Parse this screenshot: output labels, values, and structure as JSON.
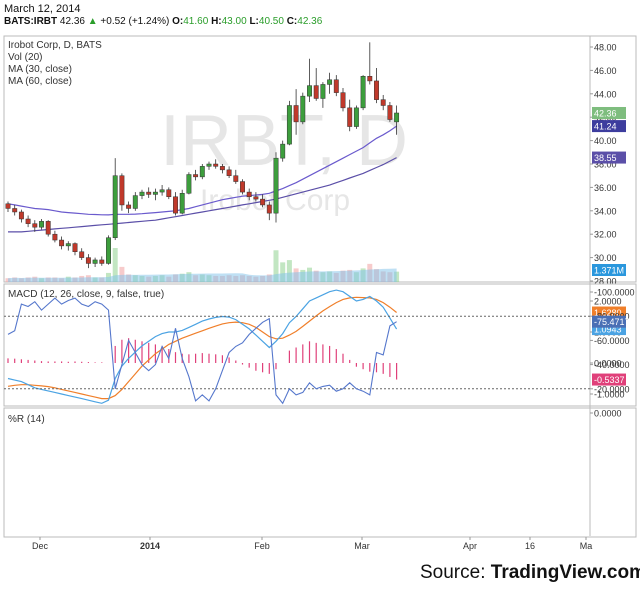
{
  "header": {
    "date": "March 12, 2014",
    "symbol": "BATS:IRBT",
    "last": "42.36",
    "change": "+0.52 (+1.24%)",
    "o_label": "O:",
    "o": "41.60",
    "h_label": "H:",
    "h": "43.00",
    "l_label": "L:",
    "l": "40.50",
    "c_label": "C:",
    "c": "42.36"
  },
  "watermark": {
    "ticker": "IRBT, D",
    "name": "Irobot Corp"
  },
  "source": {
    "prefix": "Source: ",
    "brand": "TradingView.com"
  },
  "colors": {
    "up": "#3d9e3d",
    "down": "#c0392b",
    "ma30": "#5b4fa8",
    "ma60": "#6a5acd",
    "macd": "#4ba3e3",
    "signal": "#f07f2a",
    "hist": "#e0407a",
    "willr": "#5577cc",
    "willr_band": "#ecdcf7"
  },
  "chart_data": [
    {
      "type": "candlestick",
      "title": "Irobot Corp, D, BATS",
      "legend": [
        "Irobot Corp, D, BATS",
        "Vol (20)",
        "MA (30, close)",
        "MA (60, close)"
      ],
      "x_ticks": [
        "Dec",
        "2014",
        "Feb",
        "Mar",
        "Apr",
        "16",
        "Ma"
      ],
      "y_ticks": [
        "28.00",
        "30.00",
        "32.00",
        "34.00",
        "36.00",
        "38.00",
        "40.00",
        "42.00",
        "44.00",
        "46.00",
        "48.00"
      ],
      "ylim": [
        28,
        48.5
      ],
      "last_labels": {
        "close": "42.36",
        "ma30": "41.24",
        "ma60": "38.55",
        "volume": "1.371M"
      },
      "ohlc": [
        [
          34.6,
          34.8,
          33.9,
          34.2
        ],
        [
          34.2,
          34.5,
          33.6,
          33.9
        ],
        [
          33.9,
          34.1,
          33.0,
          33.3
        ],
        [
          33.3,
          33.6,
          32.6,
          32.9
        ],
        [
          32.9,
          33.2,
          32.2,
          32.6
        ],
        [
          32.6,
          33.3,
          32.4,
          33.1
        ],
        [
          33.1,
          33.2,
          31.8,
          32.0
        ],
        [
          32.0,
          32.3,
          31.3,
          31.5
        ],
        [
          31.5,
          31.8,
          30.7,
          31.0
        ],
        [
          31.0,
          31.4,
          30.6,
          31.2
        ],
        [
          31.2,
          31.3,
          30.2,
          30.5
        ],
        [
          30.5,
          30.8,
          29.8,
          30.0
        ],
        [
          30.0,
          30.3,
          29.1,
          29.5
        ],
        [
          29.5,
          30.0,
          29.2,
          29.8
        ],
        [
          29.8,
          30.1,
          29.3,
          29.5
        ],
        [
          29.5,
          31.9,
          29.4,
          31.7
        ],
        [
          31.7,
          38.5,
          31.5,
          37.0
        ],
        [
          37.0,
          37.2,
          34.0,
          34.5
        ],
        [
          34.5,
          34.8,
          33.8,
          34.2
        ],
        [
          34.2,
          35.6,
          34.0,
          35.3
        ],
        [
          35.3,
          35.8,
          35.0,
          35.6
        ],
        [
          35.6,
          36.0,
          35.1,
          35.4
        ],
        [
          35.4,
          35.9,
          34.9,
          35.6
        ],
        [
          35.6,
          36.2,
          35.3,
          35.8
        ],
        [
          35.8,
          36.0,
          35.0,
          35.2
        ],
        [
          35.2,
          35.6,
          33.6,
          33.8
        ],
        [
          33.8,
          35.8,
          33.7,
          35.5
        ],
        [
          35.5,
          37.3,
          35.4,
          37.1
        ],
        [
          37.1,
          37.5,
          36.6,
          36.9
        ],
        [
          36.9,
          38.0,
          36.7,
          37.8
        ],
        [
          37.8,
          38.2,
          37.5,
          38.0
        ],
        [
          38.0,
          38.4,
          37.6,
          37.8
        ],
        [
          37.8,
          38.0,
          37.2,
          37.5
        ],
        [
          37.5,
          37.8,
          36.8,
          37.0
        ],
        [
          37.0,
          37.5,
          36.3,
          36.5
        ],
        [
          36.5,
          36.7,
          35.4,
          35.6
        ],
        [
          35.6,
          35.9,
          34.9,
          35.2
        ],
        [
          35.2,
          35.6,
          34.8,
          35.0
        ],
        [
          35.0,
          35.4,
          34.3,
          34.5
        ],
        [
          34.5,
          34.8,
          33.2,
          33.8
        ],
        [
          33.8,
          39.0,
          33.0,
          38.5
        ],
        [
          38.5,
          40.0,
          38.2,
          39.7
        ],
        [
          39.7,
          43.4,
          39.6,
          43.0
        ],
        [
          43.0,
          44.4,
          40.5,
          41.6
        ],
        [
          41.6,
          44.1,
          41.4,
          43.8
        ],
        [
          43.8,
          47.0,
          43.3,
          44.7
        ],
        [
          44.7,
          46.2,
          43.4,
          43.6
        ],
        [
          43.6,
          45.0,
          42.8,
          44.8
        ],
        [
          44.8,
          45.8,
          44.0,
          45.2
        ],
        [
          45.2,
          45.6,
          43.8,
          44.1
        ],
        [
          44.1,
          44.5,
          42.5,
          42.8
        ],
        [
          42.8,
          43.5,
          40.8,
          41.2
        ],
        [
          41.2,
          43.0,
          41.0,
          42.8
        ],
        [
          42.8,
          45.6,
          42.6,
          45.5
        ],
        [
          45.5,
          48.4,
          44.8,
          45.1
        ],
        [
          45.1,
          46.2,
          43.2,
          43.5
        ],
        [
          43.5,
          43.9,
          42.6,
          43.0
        ],
        [
          43.0,
          43.3,
          41.6,
          41.8
        ],
        [
          41.6,
          43.0,
          40.5,
          42.36
        ]
      ],
      "volume": [
        0.5,
        0.6,
        0.5,
        0.6,
        0.7,
        0.5,
        0.6,
        0.6,
        0.5,
        0.7,
        0.6,
        0.8,
        0.9,
        0.6,
        0.6,
        1.2,
        4.5,
        2.0,
        1.0,
        0.9,
        0.8,
        0.7,
        0.8,
        0.9,
        0.7,
        1.0,
        1.1,
        1.3,
        0.9,
        1.0,
        0.9,
        0.8,
        0.8,
        0.9,
        0.8,
        0.9,
        0.8,
        0.7,
        0.8,
        1.0,
        4.2,
        2.6,
        2.9,
        1.8,
        1.6,
        1.9,
        1.5,
        1.3,
        1.4,
        1.2,
        1.5,
        1.6,
        1.3,
        1.8,
        2.4,
        1.7,
        1.4,
        1.3,
        1.371
      ],
      "ma30": [
        34.6,
        34.5,
        34.4,
        34.3,
        34.2,
        34.15,
        34.1,
        34.0,
        33.9,
        33.85,
        33.8,
        33.75,
        33.7,
        33.68,
        33.66,
        33.65,
        33.7,
        33.7,
        33.7,
        33.72,
        33.75,
        33.8,
        33.85,
        33.9,
        33.95,
        34.0,
        34.1,
        34.2,
        34.35,
        34.5,
        34.65,
        34.8,
        34.95,
        35.05,
        35.15,
        35.25,
        35.3,
        35.35,
        35.4,
        35.5,
        35.7,
        35.9,
        36.15,
        36.4,
        36.7,
        37.0,
        37.3,
        37.6,
        37.9,
        38.2,
        38.5,
        38.8,
        39.1,
        39.4,
        39.8,
        40.2,
        40.5,
        40.85,
        41.24
      ],
      "ma60": [
        32.2,
        32.2,
        32.2,
        32.25,
        32.3,
        32.35,
        32.4,
        32.45,
        32.5,
        32.55,
        32.6,
        32.65,
        32.7,
        32.75,
        32.8,
        32.85,
        32.9,
        32.95,
        33.0,
        33.05,
        33.1,
        33.15,
        33.2,
        33.3,
        33.4,
        33.5,
        33.6,
        33.7,
        33.8,
        33.9,
        34.0,
        34.1,
        34.2,
        34.3,
        34.4,
        34.5,
        34.6,
        34.7,
        34.8,
        34.9,
        35.0,
        35.15,
        35.3,
        35.45,
        35.6,
        35.75,
        35.9,
        36.05,
        36.2,
        36.4,
        36.6,
        36.8,
        37.0,
        37.2,
        37.45,
        37.7,
        37.95,
        38.25,
        38.55
      ]
    },
    {
      "type": "line",
      "title": "MACD (12, 26, close, 9, false, true)",
      "y_ticks": [
        "-1.0000",
        "0.0000",
        "1.0000",
        "2.0000"
      ],
      "ylim": [
        -1.55,
        2.45
      ],
      "last_labels": {
        "macd": "1.0943",
        "signal": "1.6280",
        "hist": "-0.5337"
      },
      "macd": [
        -0.5,
        -0.55,
        -0.6,
        -0.7,
        -0.8,
        -0.85,
        -0.9,
        -0.95,
        -1.0,
        -1.05,
        -1.1,
        -1.15,
        -1.2,
        -1.25,
        -1.3,
        -1.2,
        -0.5,
        -0.1,
        0.15,
        0.35,
        0.55,
        0.7,
        0.85,
        0.95,
        1.0,
        1.0,
        1.05,
        1.15,
        1.25,
        1.35,
        1.42,
        1.47,
        1.5,
        1.48,
        1.4,
        1.25,
        1.1,
        0.9,
        0.7,
        0.5,
        0.7,
        0.95,
        1.3,
        1.5,
        1.75,
        2.0,
        2.1,
        2.2,
        2.3,
        2.35,
        2.3,
        2.15,
        2.0,
        2.05,
        2.15,
        2.0,
        1.8,
        1.45,
        1.0943
      ],
      "signal": [
        -0.75,
        -0.72,
        -0.7,
        -0.7,
        -0.72,
        -0.74,
        -0.76,
        -0.8,
        -0.85,
        -0.9,
        -0.95,
        -1.0,
        -1.05,
        -1.1,
        -1.15,
        -1.15,
        -1.05,
        -0.85,
        -0.6,
        -0.35,
        -0.1,
        0.1,
        0.3,
        0.45,
        0.6,
        0.7,
        0.8,
        0.88,
        0.96,
        1.04,
        1.12,
        1.19,
        1.26,
        1.3,
        1.32,
        1.3,
        1.25,
        1.15,
        1.0,
        0.85,
        0.78,
        0.8,
        0.9,
        1.02,
        1.18,
        1.35,
        1.52,
        1.68,
        1.82,
        1.95,
        2.05,
        2.1,
        2.12,
        2.11,
        2.1,
        2.05,
        1.95,
        1.8,
        1.628
      ],
      "hist": [
        0.15,
        0.14,
        0.12,
        0.1,
        0.08,
        0.06,
        0.05,
        0.05,
        0.05,
        0.04,
        0.05,
        0.04,
        0.03,
        0.02,
        0.02,
        0.0,
        0.55,
        0.75,
        0.8,
        0.75,
        0.7,
        0.65,
        0.6,
        0.55,
        0.45,
        0.35,
        0.3,
        0.28,
        0.3,
        0.32,
        0.3,
        0.28,
        0.25,
        0.18,
        0.08,
        -0.05,
        -0.15,
        -0.25,
        -0.3,
        -0.35,
        -0.2,
        0.0,
        0.4,
        0.5,
        0.6,
        0.7,
        0.65,
        0.6,
        0.55,
        0.45,
        0.3,
        0.1,
        -0.12,
        -0.2,
        -0.28,
        -0.3,
        -0.35,
        -0.45,
        -0.5337
      ]
    },
    {
      "type": "line",
      "title": "%R (14)",
      "y_ticks": [
        "-100.0000",
        "-80.0000",
        "-60.0000",
        "-40.0000",
        "-20.0000",
        "0.0000"
      ],
      "ylim": [
        -100,
        0
      ],
      "band": [
        -80,
        -20
      ],
      "last_label": "-75.4717",
      "values": [
        -65,
        -68,
        -90,
        -88,
        -92,
        -85,
        -90,
        -95,
        -90,
        -93,
        -95,
        -90,
        -88,
        -92,
        -90,
        -85,
        -20,
        -40,
        -60,
        -50,
        -40,
        -35,
        -40,
        -55,
        -45,
        -70,
        -45,
        -30,
        -10,
        -15,
        -10,
        -20,
        -35,
        -50,
        -55,
        -58,
        -65,
        -70,
        -75,
        -78,
        -15,
        -8,
        -20,
        -15,
        -17,
        -25,
        -20,
        -22,
        -23,
        -18,
        -20,
        -25,
        -20,
        -18,
        -15,
        -50,
        -48,
        -72,
        -75.4717
      ]
    }
  ]
}
